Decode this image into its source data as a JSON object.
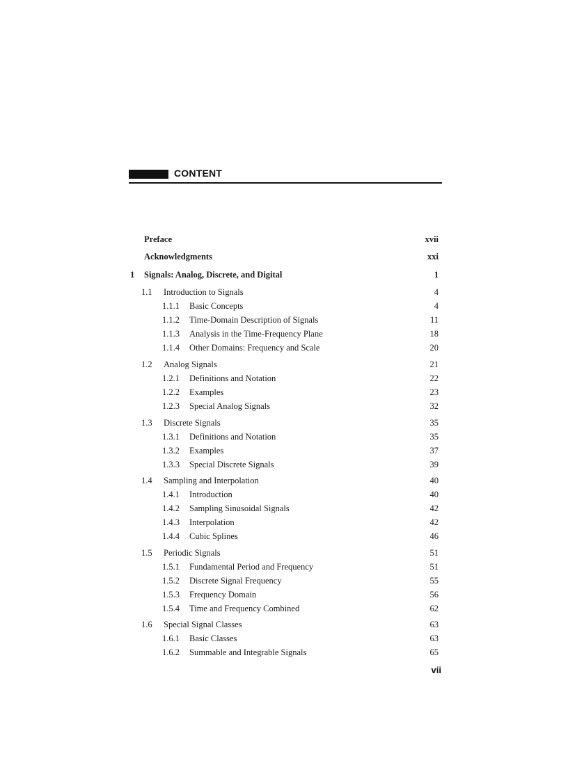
{
  "header": {
    "title": "CONTENT"
  },
  "folio": "vii",
  "entries": [
    {
      "level": 0,
      "bold": true,
      "num": "",
      "title": "Preface",
      "page": "xvii"
    },
    {
      "level": 0,
      "bold": true,
      "num": "",
      "title": "Acknowledgments",
      "page": "xxi"
    },
    {
      "level": 0,
      "bold": true,
      "num": "1",
      "title": "Signals: Analog, Discrete, and Digital",
      "page": "1"
    },
    {
      "level": 1,
      "num": "1.1",
      "title": "Introduction to Signals",
      "page": "4"
    },
    {
      "level": 2,
      "num": "1.1.1",
      "title": "Basic Concepts",
      "page": "4"
    },
    {
      "level": 2,
      "num": "1.1.2",
      "title": "Time-Domain Description of Signals",
      "page": "11"
    },
    {
      "level": 2,
      "num": "1.1.3",
      "title": "Analysis in the Time-Frequency Plane",
      "page": "18"
    },
    {
      "level": 2,
      "num": "1.1.4",
      "title": "Other Domains: Frequency and Scale",
      "page": "20"
    },
    {
      "level": 1,
      "num": "1.2",
      "title": "Analog Signals",
      "page": "21"
    },
    {
      "level": 2,
      "num": "1.2.1",
      "title": "Definitions and Notation",
      "page": "22"
    },
    {
      "level": 2,
      "num": "1.2.2",
      "title": "Examples",
      "page": "23"
    },
    {
      "level": 2,
      "num": "1.2.3",
      "title": "Special Analog Signals",
      "page": "32"
    },
    {
      "level": 1,
      "num": "1.3",
      "title": "Discrete Signals",
      "page": "35"
    },
    {
      "level": 2,
      "num": "1.3.1",
      "title": "Definitions and Notation",
      "page": "35"
    },
    {
      "level": 2,
      "num": "1.3.2",
      "title": "Examples",
      "page": "37"
    },
    {
      "level": 2,
      "num": "1.3.3",
      "title": "Special Discrete Signals",
      "page": "39"
    },
    {
      "level": 1,
      "num": "1.4",
      "title": "Sampling and Interpolation",
      "page": "40"
    },
    {
      "level": 2,
      "num": "1.4.1",
      "title": "Introduction",
      "page": "40"
    },
    {
      "level": 2,
      "num": "1.4.2",
      "title": "Sampling Sinusoidal Signals",
      "page": "42"
    },
    {
      "level": 2,
      "num": "1.4.3",
      "title": "Interpolation",
      "page": "42"
    },
    {
      "level": 2,
      "num": "1.4.4",
      "title": "Cubic Splines",
      "page": "46"
    },
    {
      "level": 1,
      "num": "1.5",
      "title": "Periodic Signals",
      "page": "51"
    },
    {
      "level": 2,
      "num": "1.5.1",
      "title": "Fundamental Period and Frequency",
      "page": "51"
    },
    {
      "level": 2,
      "num": "1.5.2",
      "title": "Discrete Signal Frequency",
      "page": "55"
    },
    {
      "level": 2,
      "num": "1.5.3",
      "title": "Frequency Domain",
      "page": "56"
    },
    {
      "level": 2,
      "num": "1.5.4",
      "title": "Time and Frequency Combined",
      "page": "62"
    },
    {
      "level": 1,
      "num": "1.6",
      "title": "Special Signal Classes",
      "page": "63"
    },
    {
      "level": 2,
      "num": "1.6.1",
      "title": "Basic Classes",
      "page": "63"
    },
    {
      "level": 2,
      "num": "1.6.2",
      "title": "Summable and Integrable Signals",
      "page": "65"
    }
  ]
}
